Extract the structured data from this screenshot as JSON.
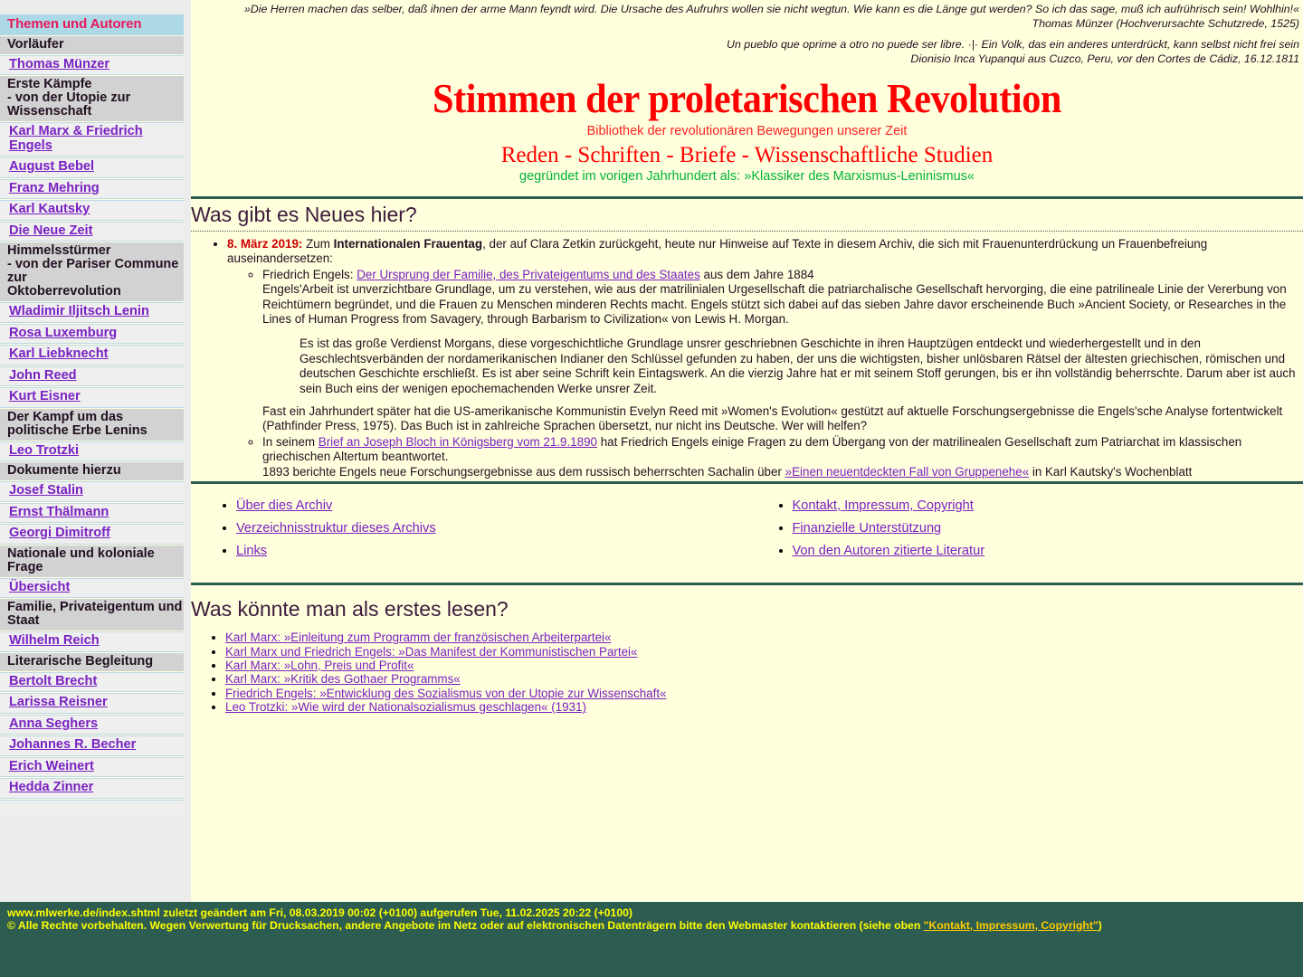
{
  "site": {
    "masthead_title": "Stimmen der proletarischen Revolution",
    "masthead_sub1": "Bibliothek der revolutionären Bewegungen unserer Zeit",
    "masthead_title2": "Reden - Schriften - Briefe - Wissenschaftliche Studien",
    "masthead_sub2": "gegründet im vorigen Jahrhundert als: »Klassiker des Marxismus-Leninismus«",
    "accent_red": "#ff0000",
    "accent_green": "#00b33c",
    "link_purple": "#7a22c2",
    "rule_green": "#2d5c50",
    "footer_bg": "#2d5c50",
    "footer_text": "#ffff00",
    "sidebar_header_bg": "#add8e6",
    "sidebar_header_color": "#e8185a",
    "page_bg": "#ffffdd"
  },
  "quotes": [
    {
      "text": "»Die Herren machen das selber, daß ihnen der arme Mann feyndt wird. Die Ursache des Aufruhrs wollen sie nicht wegtun. Wie kann es die Länge gut werden? So ich das sage, muß ich aufrührisch sein! Wohlhin!«",
      "attribution": "Thomas Münzer (Hochverursachte Schutzrede, 1525)"
    },
    {
      "text": "Un pueblo que oprime a otro no puede ser libre. ·|· Ein Volk, das ein anderes unterdrückt, kann selbst nicht frei sein",
      "attribution": "Dionisio Inca Yupanqui aus Cuzco, Peru, vor den Cortes de Cádiz, 16.12.1811"
    }
  ],
  "sidebar": {
    "header": "Themen und Autoren",
    "groups": [
      {
        "heading": "Vorläufer",
        "links": [
          "Thomas Münzer"
        ]
      },
      {
        "heading": "Erste Kämpfe\n- von der Utopie zur\nWissenschaft",
        "links": [
          "Karl Marx & Friedrich Engels",
          "August Bebel",
          "Franz Mehring",
          "Karl Kautsky",
          "Die Neue Zeit"
        ]
      },
      {
        "heading": "Himmelsstürmer\n- von der Pariser Commune zur\nOktoberrevolution",
        "links": [
          "Wladimir Iljitsch Lenin",
          "Rosa Luxemburg",
          "Karl Liebknecht",
          "John Reed",
          "Kurt Eisner"
        ]
      },
      {
        "heading": "Der Kampf um das\npolitische Erbe Lenins",
        "links": [
          "Leo Trotzki"
        ]
      },
      {
        "heading": "Dokumente hierzu",
        "links": [
          "Josef Stalin",
          "Ernst Thälmann",
          "Georgi Dimitroff"
        ]
      },
      {
        "heading": "Nationale und koloniale Frage",
        "links": [
          "Übersicht"
        ]
      },
      {
        "heading": "Familie, Privateigentum und\nStaat",
        "links": [
          "Wilhelm Reich"
        ]
      },
      {
        "heading": "Literarische Begleitung",
        "links": [
          "Bertolt Brecht",
          "Larissa Reisner",
          "Anna Seghers",
          "Johannes R. Becher",
          "Erich Weinert",
          "Hedda Zinner"
        ]
      }
    ]
  },
  "news": {
    "title": "Was gibt es Neues hier?",
    "item_date": "8. März 2019:",
    "item_intro_a": "Zum ",
    "item_intro_bold": "Internationalen Frauentag",
    "item_intro_b": ", der auf Clara Zetkin zurückgeht, heute nur Hinweise auf Texte in diesem Archiv, die sich mit Frauenunterdrückung un Frauenbefreiung auseinandersetzen:",
    "sub1_pre": "Friedrich Engels: ",
    "sub1_link": "Der Ursprung der Familie, des Privateigentums und des Staates",
    "sub1_post": " aus dem Jahre 1884",
    "sub1_body": "Engels'Arbeit ist unverzichtbare Grundlage, um zu verstehen, wie aus der matrilinialen Urgesellschaft die patriarchalische Gesellschaft hervorging, die eine patrilineale Linie der Vererbung von Reichtümern begründet, und die Frauen zu Menschen minderen Rechts macht. Engels stützt sich dabei auf das sieben Jahre davor erscheinende Buch »Ancient Society, or Researches in the Lines of Human Progress from Savagery, through Barbarism to Civilization« von Lewis H. Morgan.",
    "sub1_quote": "Es ist das große Verdienst Morgans, diese vorgeschichtliche Grundlage unsrer geschriebnen Geschichte in ihren Hauptzügen entdeckt und wiederhergestellt und in den Geschlechtsverbänden der nordamerikanischen Indianer den Schlüssel gefunden zu haben, der uns die wichtigsten, bisher unlösbaren Rätsel der ältesten griechischen, römischen und deutschen Geschichte erschließt. Es ist aber seine Schrift kein Eintagswerk. An die vierzig Jahre hat er mit seinem Stoff gerungen, bis er ihn vollständig beherrschte. Darum aber ist auch sein Buch eins der wenigen epochemachenden Werke unsrer Zeit.",
    "sub1_after": "Fast ein Jahrhundert später hat die US-amerikanische Kommunistin Evelyn Reed mit »Women's Evolution« gestützt auf aktuelle Forschungsergebnisse die Engels'sche Analyse fortentwickelt (Pathfinder Press, 1975). Das Buch ist in zahlreiche Sprachen übersetzt, nur nicht ins Deutsche. Wer will helfen?",
    "sub2_pre": "In seinem ",
    "sub2_link": "Brief an Joseph Bloch in Königsberg vom 21.9.1890",
    "sub2_post": " hat Friedrich Engels einige Fragen zu dem Übergang von der matrilinealen Gesellschaft zum Patriarchat im klassischen griechischen Altertum beantwortet.",
    "sub2_line2_pre": "1893 berichte Engels neue Forschungsergebnisse aus dem russisch beherrschten Sachalin über ",
    "sub2_line2_link": "»Einen neuentdeckten Fall von Gruppenehe«",
    "sub2_line2_post": " in Karl Kautsky's Wochenblatt"
  },
  "link_columns": {
    "left": [
      "Über dies Archiv",
      "Verzeichnisstruktur dieses Archivs",
      "Links"
    ],
    "right": [
      "Kontakt, Impressum, Copyright",
      "Finanzielle Unterstützung",
      "Von den Autoren zitierte Literatur"
    ]
  },
  "reading": {
    "title": "Was könnte man als erstes lesen?",
    "items": [
      "Karl Marx: »Einleitung zum Programm der französischen Arbeiterpartei«",
      "Karl Marx und Friedrich Engels: »Das Manifest der Kommunistischen Partei«",
      "Karl Marx: »Lohn, Preis und Profit«",
      "Karl Marx: »Kritik des Gothaer Programms«",
      "Friedrich Engels: »Entwicklung des Sozialismus von der Utopie zur Wissenschaft«",
      "Leo Trotzki: »Wie wird der Nationalsozialismus geschlagen« (1931)"
    ]
  },
  "footer": {
    "line1": "www.mlwerke.de/index.shtml zuletzt geändert am Fri, 08.03.2019 00:02 (+0100) aufgerufen Tue, 11.02.2025 20:22 (+0100)",
    "line2_pre": "© Alle Rechte vorbehalten. Wegen Verwertung für Drucksachen, andere Angebote im Netz oder auf elektronischen Datenträgern bitte den Webmaster kontaktieren (siehe oben ",
    "line2_link": "\"Kontakt, Impressum, Copyright\"",
    "line2_post": ")"
  }
}
